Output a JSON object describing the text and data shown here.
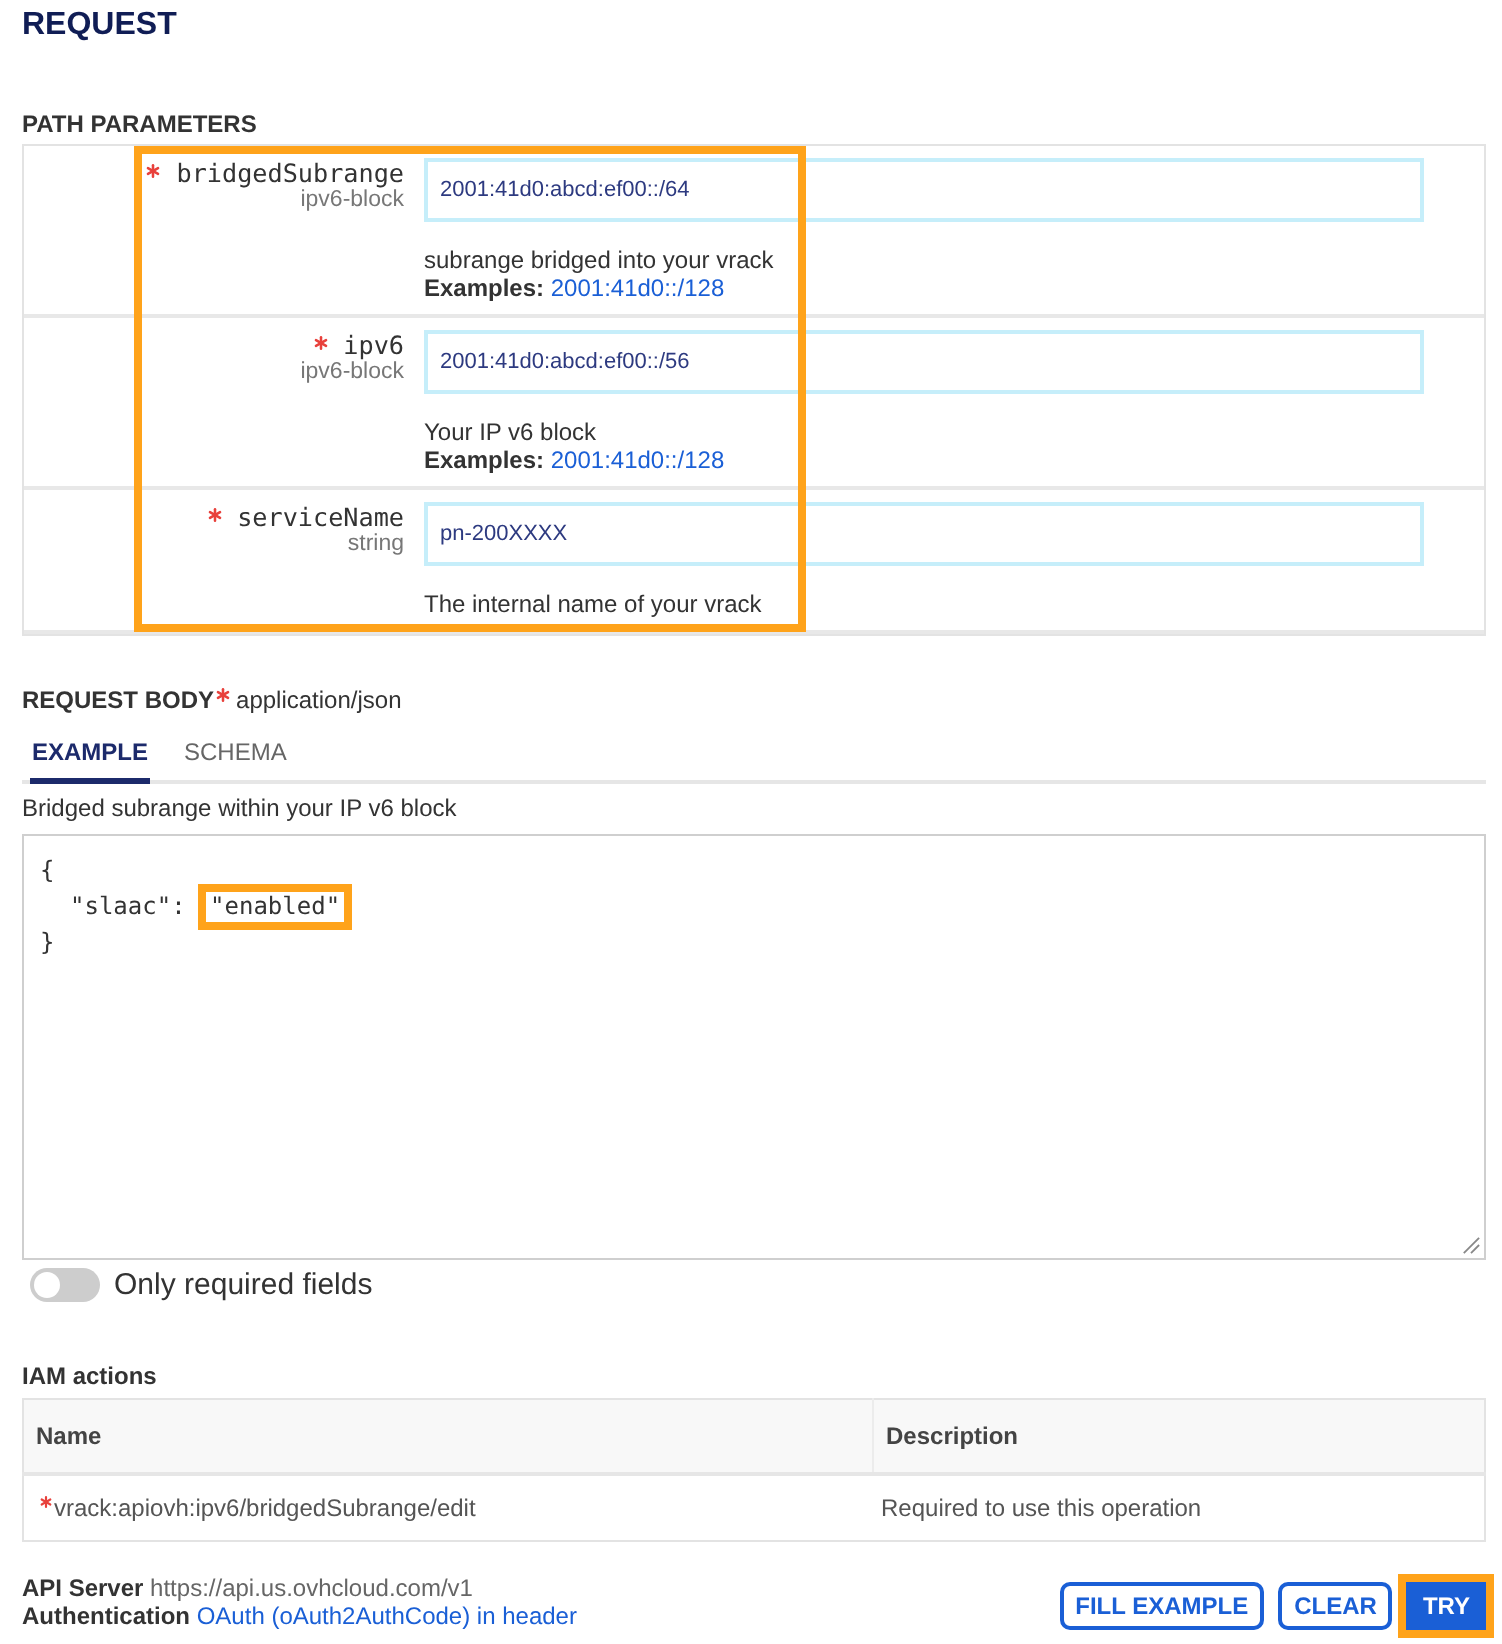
{
  "title": "REQUEST",
  "path_parameters": {
    "heading": "PATH PARAMETERS",
    "highlighted": true,
    "params": [
      {
        "name": "bridgedSubrange",
        "required": true,
        "type": "ipv6-block",
        "value": "2001:41d0:abcd:ef00::/64",
        "description": "subrange bridged into your vrack",
        "examples_label": "Examples:",
        "example": "2001:41d0::/128"
      },
      {
        "name": "ipv6",
        "required": true,
        "type": "ipv6-block",
        "value": "2001:41d0:abcd:ef00::/56",
        "description": "Your IP v6 block",
        "examples_label": "Examples:",
        "example": "2001:41d0::/128"
      },
      {
        "name": "serviceName",
        "required": true,
        "type": "string",
        "value": "pn-200XXXX",
        "description": "The internal name of your vrack"
      }
    ]
  },
  "request_body": {
    "heading": "REQUEST BODY",
    "required": true,
    "content_type": "application/json",
    "tabs": [
      {
        "label": "EXAMPLE",
        "selected": true
      },
      {
        "label": "SCHEMA",
        "selected": false
      }
    ],
    "description": "Bridged subrange within your IP v6 block",
    "example": {
      "open": "{",
      "entries": [
        {
          "key": "\"slaac\":",
          "value": "\"enabled\"",
          "highlighted": true
        }
      ],
      "close": "}"
    }
  },
  "toggle": {
    "label": "Only required fields",
    "on": false
  },
  "iam_actions": {
    "heading": "IAM actions",
    "columns": [
      "Name",
      "Description"
    ],
    "rows": [
      {
        "required": true,
        "name": "vrack:apiovh:ipv6/bridgedSubrange/edit",
        "description": "Required to use this operation"
      }
    ]
  },
  "api_server": {
    "label": "API Server",
    "value": "https://api.us.ovhcloud.com/v1"
  },
  "authentication": {
    "label": "Authentication",
    "link": "OAuth (oAuth2AuthCode) in header"
  },
  "buttons": [
    {
      "label": "FILL EXAMPLE",
      "kind": "outline",
      "highlighted": false
    },
    {
      "label": "CLEAR",
      "kind": "outline",
      "highlighted": false
    },
    {
      "label": "TRY",
      "kind": "primary",
      "highlighted": true
    }
  ]
}
